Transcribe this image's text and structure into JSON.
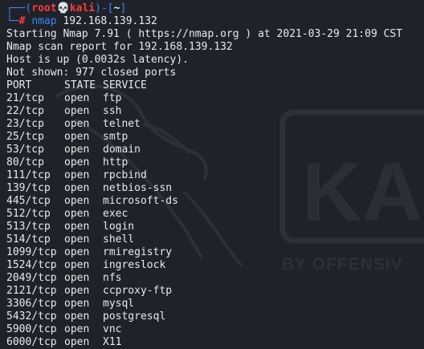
{
  "watermark": {
    "logo_text": "KA",
    "tagline": "BY OFFENSIV"
  },
  "prompt": {
    "open": "┌──(",
    "user": "root",
    "skull": "💀",
    "host": "kali",
    "mid": ")-[",
    "path": "~",
    "close": "]",
    "second_prefix": "└─",
    "symbol": "#",
    "command": "nmap",
    "args": " 192.168.139.132"
  },
  "output": {
    "start": "Starting Nmap 7.91 ( https://nmap.org ) at 2021-03-29 21:09 CST",
    "report": "Nmap scan report for 192.168.139.132",
    "host_up": "Host is up (0.0032s latency).",
    "not_shown": "Not shown: 977 closed ports"
  },
  "table": {
    "headers": [
      "PORT",
      "STATE",
      "SERVICE"
    ],
    "rows": [
      {
        "port": "21/tcp",
        "state": "open",
        "service": "ftp"
      },
      {
        "port": "22/tcp",
        "state": "open",
        "service": "ssh"
      },
      {
        "port": "23/tcp",
        "state": "open",
        "service": "telnet"
      },
      {
        "port": "25/tcp",
        "state": "open",
        "service": "smtp"
      },
      {
        "port": "53/tcp",
        "state": "open",
        "service": "domain"
      },
      {
        "port": "80/tcp",
        "state": "open",
        "service": "http"
      },
      {
        "port": "111/tcp",
        "state": "open",
        "service": "rpcbind"
      },
      {
        "port": "139/tcp",
        "state": "open",
        "service": "netbios-ssn"
      },
      {
        "port": "445/tcp",
        "state": "open",
        "service": "microsoft-ds"
      },
      {
        "port": "512/tcp",
        "state": "open",
        "service": "exec"
      },
      {
        "port": "513/tcp",
        "state": "open",
        "service": "login"
      },
      {
        "port": "514/tcp",
        "state": "open",
        "service": "shell"
      },
      {
        "port": "1099/tcp",
        "state": "open",
        "service": "rmiregistry"
      },
      {
        "port": "1524/tcp",
        "state": "open",
        "service": "ingreslock"
      },
      {
        "port": "2049/tcp",
        "state": "open",
        "service": "nfs"
      },
      {
        "port": "2121/tcp",
        "state": "open",
        "service": "ccproxy-ftp"
      },
      {
        "port": "3306/tcp",
        "state": "open",
        "service": "mysql"
      },
      {
        "port": "5432/tcp",
        "state": "open",
        "service": "postgresql"
      },
      {
        "port": "5900/tcp",
        "state": "open",
        "service": "vnc"
      },
      {
        "port": "6000/tcp",
        "state": "open",
        "service": "X11"
      }
    ]
  },
  "colors": {
    "background": "#1f2229",
    "prompt_blue": "#3a86f0",
    "prompt_red": "#ff3b3b",
    "text": "#e9eaec"
  }
}
